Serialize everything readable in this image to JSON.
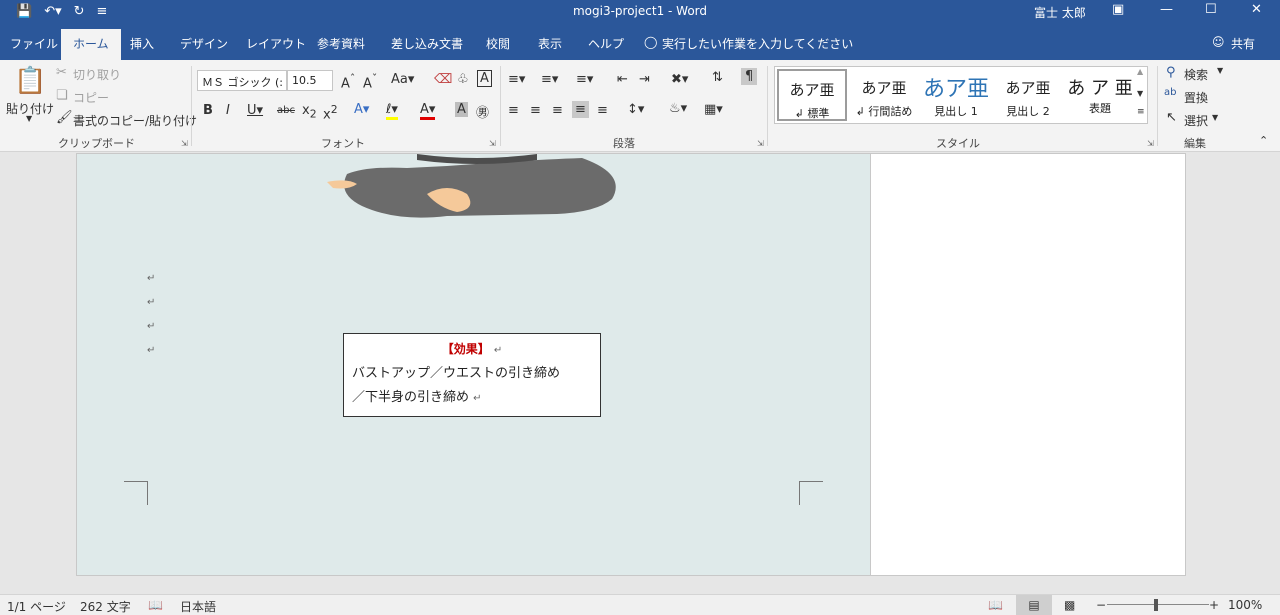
{
  "titlebar": {
    "title": "mogi3-project1  -  Word",
    "user": "富士 太郎",
    "qat": {
      "save_icon": "save-icon",
      "undo_icon": "undo-icon",
      "redo_icon": "redo-icon",
      "customize_icon": "customize-icon"
    }
  },
  "tabs": [
    "ファイル",
    "ホーム",
    "挿入",
    "デザイン",
    "レイアウト",
    "参考資料",
    "差し込み文書",
    "校閲",
    "表示",
    "ヘルプ"
  ],
  "tell_me": "実行したい作業を入力してください",
  "share": "共有",
  "clipboard": {
    "paste": "貼り付け",
    "cut": "切り取り",
    "copy": "コピー",
    "format_painter": "書式のコピー/貼り付け",
    "label": "クリップボード"
  },
  "font": {
    "family": "ＭＳ ゴシック (:",
    "size": "10.5",
    "label": "フォント"
  },
  "paragraph": {
    "label": "段落"
  },
  "styles": {
    "label": "スタイル",
    "items": [
      {
        "preview": "あア亜",
        "name": "↲ 標準"
      },
      {
        "preview": "あア亜",
        "name": "↲ 行間詰め"
      },
      {
        "preview": "あア亜",
        "name": "見出し 1"
      },
      {
        "preview": "あア亜",
        "name": "見出し 2"
      },
      {
        "preview": "あ ア 亜",
        "name": "表題"
      }
    ]
  },
  "editing": {
    "find": "検索",
    "replace": "置換",
    "select": "選択",
    "label": "編集"
  },
  "document": {
    "para_mark": "↵",
    "textbox": {
      "title": "【効果】",
      "line1": "バストアップ／ウエストの引き締め",
      "line2": "／下半身の引き締め"
    }
  },
  "status": {
    "page": "1/1 ページ",
    "words": "262 文字",
    "language": "日本語",
    "zoom": "100%"
  },
  "colors": {
    "brand": "#2b579a",
    "effect_title": "#c00000"
  }
}
